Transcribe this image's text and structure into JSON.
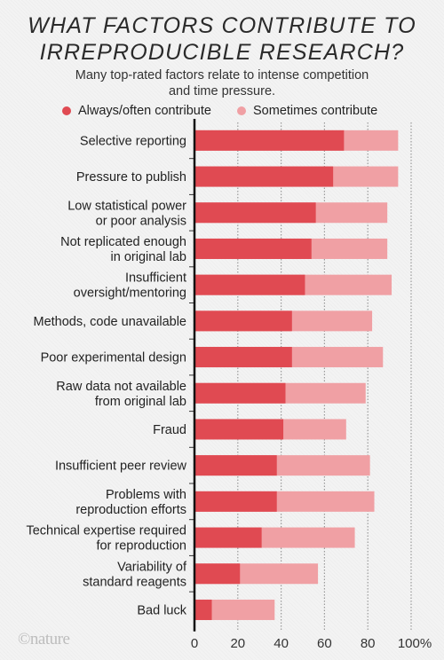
{
  "chart_data": {
    "type": "bar",
    "orientation": "horizontal",
    "stacked": false,
    "title": "WHAT FACTORS CONTRIBUTE TO IRREPRODUCIBLE RESEARCH?",
    "title_lines": [
      "WHAT FACTORS CONTRIBUTE TO",
      "IRREPRODUCIBLE RESEARCH?"
    ],
    "subtitle_lines": [
      "Many top-rated factors relate to intense competition",
      "and time pressure."
    ],
    "xlabel": "",
    "ylabel": "",
    "xlim": [
      0,
      100
    ],
    "xticks": [
      0,
      20,
      40,
      60,
      80,
      100
    ],
    "xtick_labels": [
      "0",
      "20",
      "40",
      "60",
      "80",
      "100%"
    ],
    "grid": "vertical dotted",
    "legend_position": "top",
    "categories": [
      [
        "Selective reporting"
      ],
      [
        "Pressure to publish"
      ],
      [
        "Low statistical power",
        "or poor analysis"
      ],
      [
        "Not replicated enough",
        "in original lab"
      ],
      [
        "Insufficient",
        "oversight/mentoring"
      ],
      [
        "Methods, code unavailable"
      ],
      [
        "Poor experimental design"
      ],
      [
        "Raw data not available",
        "from original lab"
      ],
      [
        "Fraud"
      ],
      [
        "Insufficient peer review"
      ],
      [
        "Problems with",
        "reproduction efforts"
      ],
      [
        "Technical expertise required",
        "for reproduction"
      ],
      [
        "Variability of",
        "standard reagents"
      ],
      [
        "Bad luck"
      ]
    ],
    "series": [
      {
        "name": "Always/often contribute",
        "color": "#e04a52",
        "values": [
          69,
          64,
          56,
          54,
          51,
          45,
          45,
          42,
          41,
          38,
          38,
          31,
          21,
          8
        ]
      },
      {
        "name": "Sometimes contribute",
        "color": "#f0a0a4",
        "note": "cumulative total (always/often + sometimes)",
        "values": [
          94,
          94,
          89,
          89,
          91,
          82,
          87,
          79,
          70,
          81,
          83,
          74,
          57,
          37
        ]
      }
    ]
  },
  "footer": {
    "logo": "©nature"
  }
}
